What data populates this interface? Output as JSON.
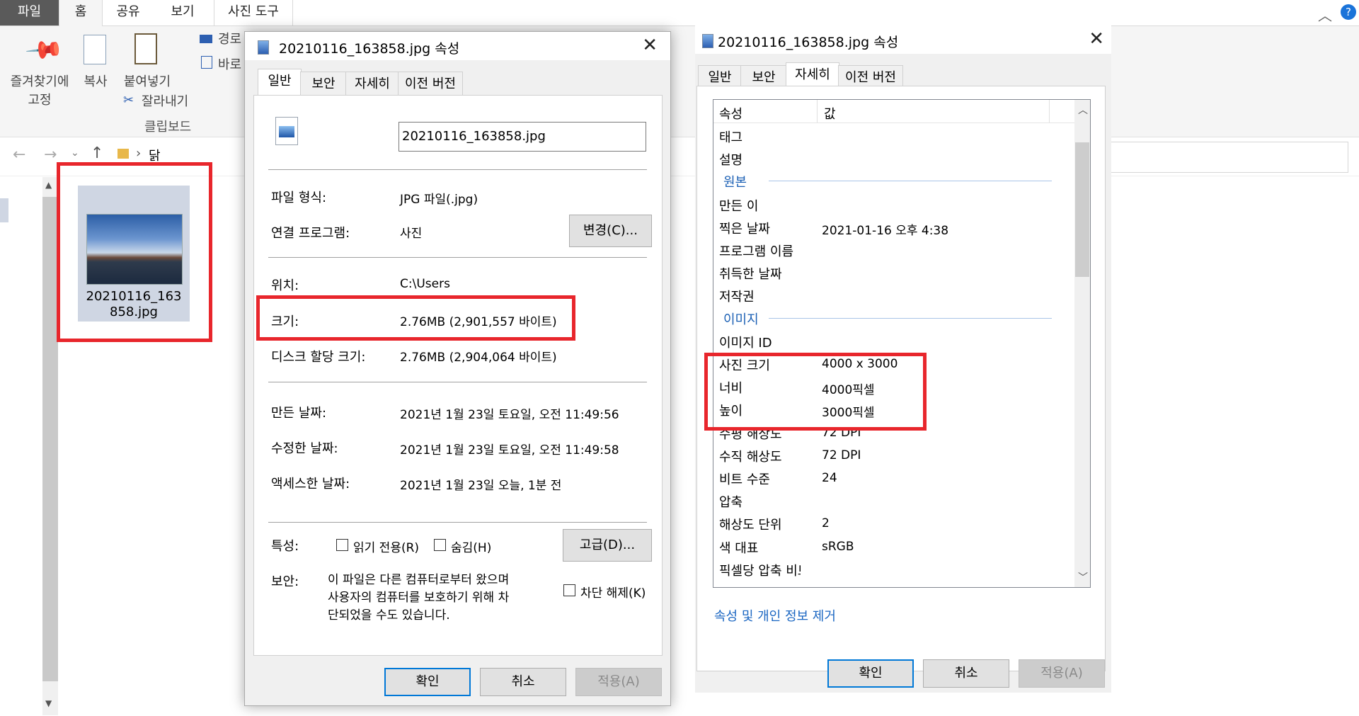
{
  "ribbon": {
    "tabs": [
      "파일",
      "홈",
      "공유",
      "보기",
      "사진 도구"
    ],
    "pin_label_line1": "즐겨찾기에",
    "pin_label_line2": "고정",
    "copy_label": "복사",
    "paste_label": "붙여넣기",
    "path_label": "경로",
    "shortcut_label": "바로",
    "cut_label": "잘라내기",
    "group_label": "클립보드"
  },
  "address": {
    "folder": "닭"
  },
  "file_item": {
    "name_line1": "20210116_163",
    "name_line2": "858.jpg"
  },
  "dialog1": {
    "title": "20210116_163858.jpg 속성",
    "tabs": [
      "일반",
      "보안",
      "자세히",
      "이전 버전"
    ],
    "filename": "20210116_163858.jpg",
    "file_type_label": "파일 형식:",
    "file_type_value": "JPG 파일(.jpg)",
    "open_with_label": "연결 프로그램:",
    "open_with_value": "사진",
    "change_button": "변경(C)...",
    "location_label": "위치:",
    "location_value": "C:\\Users",
    "size_label": "크기:",
    "size_value": "2.76MB (2,901,557 바이트)",
    "disk_size_label": "디스크 할당 크기:",
    "disk_size_value": "2.76MB (2,904,064 바이트)",
    "created_label": "만든 날짜:",
    "created_value": "2021년 1월 23일 토요일, 오전 11:49:56",
    "modified_label": "수정한 날짜:",
    "modified_value": "2021년 1월 23일 토요일, 오전 11:49:58",
    "accessed_label": "액세스한 날짜:",
    "accessed_value": "2021년 1월 23일 오늘, 1분 전",
    "attributes_label": "특성:",
    "readonly_label": "읽기 전용(R)",
    "hidden_label": "숨김(H)",
    "advanced_button": "고급(D)...",
    "security_label": "보안:",
    "security_text_line1": "이 파일은 다른 컴퓨터로부터 왔으며",
    "security_text_line2": "사용자의 컴퓨터를 보호하기 위해 차",
    "security_text_line3": "단되었을 수도 있습니다.",
    "unblock_label": "차단 해제(K)",
    "ok_button": "확인",
    "cancel_button": "취소",
    "apply_button": "적용(A)"
  },
  "dialog2": {
    "title": "20210116_163858.jpg 속성",
    "tabs": [
      "일반",
      "보안",
      "자세히",
      "이전 버전"
    ],
    "header_property": "속성",
    "header_value": "값",
    "rows": [
      {
        "name": "태그",
        "value": ""
      },
      {
        "name": "설명",
        "value": ""
      },
      {
        "group": "원본"
      },
      {
        "name": "만든 이",
        "value": ""
      },
      {
        "name": "찍은 날짜",
        "value": "2021-01-16 오후 4:38"
      },
      {
        "name": "프로그램 이름",
        "value": ""
      },
      {
        "name": "취득한 날짜",
        "value": ""
      },
      {
        "name": "저작권",
        "value": ""
      },
      {
        "group": "이미지"
      },
      {
        "name": "이미지 ID",
        "value": ""
      },
      {
        "name": "사진 크기",
        "value": "4000 x 3000"
      },
      {
        "name": "너비",
        "value": "4000픽셀"
      },
      {
        "name": "높이",
        "value": "3000픽셀"
      },
      {
        "name": "수평 해상도",
        "value": "72 DPI"
      },
      {
        "name": "수직 해상도",
        "value": "72 DPI"
      },
      {
        "name": "비트 수준",
        "value": "24"
      },
      {
        "name": "압축",
        "value": ""
      },
      {
        "name": "해상도 단위",
        "value": "2"
      },
      {
        "name": "색 대표",
        "value": "sRGB"
      },
      {
        "name": "픽셀당 압축 비트",
        "value": ""
      }
    ],
    "remove_link": "속성 및 개인 정보 제거",
    "ok_button": "확인",
    "cancel_button": "취소",
    "apply_button": "적용(A)"
  },
  "colors": {
    "highlight_red": "#e8262c",
    "link_blue": "#1a66c2",
    "accent_blue": "#0078d7"
  }
}
